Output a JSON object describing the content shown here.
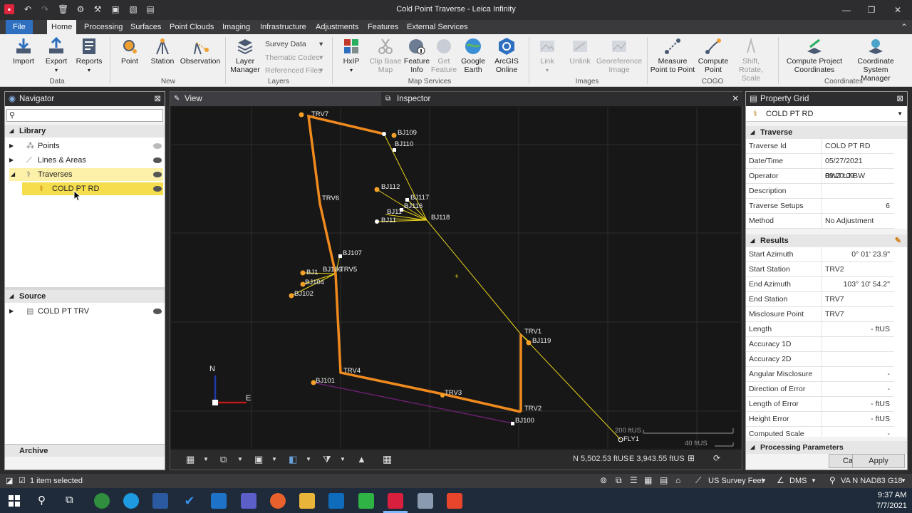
{
  "window": {
    "title": "Cold Point Traverse - Leica Infinity"
  },
  "menu": {
    "tabs": [
      "File",
      "Home",
      "Processing",
      "Surfaces",
      "Point Clouds",
      "Imaging",
      "Infrastructure",
      "Adjustments",
      "Features",
      "External Services"
    ]
  },
  "ribbon": {
    "import": "Import",
    "export": "Export",
    "reports": "Reports",
    "group_data": "Data",
    "point": "Point",
    "station": "Station",
    "observation": "Observation",
    "group_new": "New",
    "layer_manager": "Layer Manager",
    "survey_data": "Survey Data",
    "thematic_codes": "Thematic Codes",
    "referenced_files": "Referenced Files",
    "group_layers": "Layers",
    "hxip": "HxIP",
    "clip_base_map": "Clip Base Map",
    "feature_info": "Feature Info",
    "get_feature": "Get Feature",
    "google_earth": "Google Earth",
    "arcgis_online": "ArcGIS Online",
    "group_map_services": "Map Services",
    "link": "Link",
    "unlink": "Unlink",
    "georeference_image": "Georeference Image",
    "group_images": "Images",
    "measure_point": "Measure Point to Point",
    "compute_point": "Compute Point",
    "shift_rotate": "Shift, Rotate, Scale",
    "group_cogo": "COGO",
    "compute_project_coords": "Compute Project Coordinates",
    "coordinate_system_manager": "Coordinate System Manager",
    "group_coordinates": "Coordinates"
  },
  "navigator": {
    "title": "Navigator",
    "search_placeholder": "",
    "library": "Library",
    "items": [
      "Points",
      "Lines & Areas",
      "Traverses",
      "COLD PT RD"
    ],
    "source": "Source",
    "source_items": [
      "COLD PT TRV"
    ],
    "archive": "Archive"
  },
  "view": {
    "tab_view": "View",
    "tab_inspector": "Inspector",
    "coord_n": "N 5,502.53 ftUS",
    "coord_e": "E 3,943.55 ftUS",
    "scale_big": "200 ftUS",
    "scale_small": "40 ftUS",
    "north": "N",
    "east": "E",
    "labels": {
      "TRV7": "TRV7",
      "BJ109": "BJ109",
      "BJ110": "BJ110",
      "BJ112": "BJ112",
      "BJ117": "BJ117",
      "BJ116": "BJ116",
      "BJ11a": "BJ11",
      "BJ11b": "BJ11",
      "BJ118": "BJ118",
      "TRV6": "TRV6",
      "BJ107": "BJ107",
      "BJ1a": "BJ1",
      "BJ106": "BJ106",
      "TRV5": "TRV5",
      "BJ104": "BJ104",
      "BJ102": "BJ102",
      "TRV1": "TRV1",
      "BJ119": "BJ119",
      "TRV4": "TRV4",
      "BJ101": "BJ101",
      "TRV3": "TRV3",
      "TRV2": "TRV2",
      "BJ100": "BJ100",
      "FLY1": "FLY1"
    }
  },
  "property_grid": {
    "title": "Property Grid",
    "selector": "COLD PT RD",
    "section_traverse": "Traverse",
    "traverse": [
      {
        "k": "Traverse Id",
        "v": "COLD PT RD"
      },
      {
        "k": "Date/Time",
        "v": "05/27/2021 09:20:09"
      },
      {
        "k": "Operator",
        "v": "BWJ LJ BW"
      },
      {
        "k": "Description",
        "v": ""
      },
      {
        "k": "Traverse Setups",
        "v": "6"
      },
      {
        "k": "Method",
        "v": "No Adjustment"
      }
    ],
    "section_results": "Results",
    "results": [
      {
        "k": "Start Azimuth",
        "v": "0° 01' 23.9\""
      },
      {
        "k": "Start Station",
        "v": "TRV2"
      },
      {
        "k": "End Azimuth",
        "v": "103° 10' 54.2\""
      },
      {
        "k": "End Station",
        "v": "TRV7"
      },
      {
        "k": "Misclosure Point",
        "v": "TRV7"
      },
      {
        "k": "Length",
        "v": "- ftUS"
      },
      {
        "k": "Accuracy 1D",
        "v": ""
      },
      {
        "k": "Accuracy 2D",
        "v": ""
      },
      {
        "k": "Angular Misclosure",
        "v": "-"
      },
      {
        "k": "Direction of Error",
        "v": "-"
      },
      {
        "k": "Length of Error",
        "v": "- ftUS"
      },
      {
        "k": "Height Error",
        "v": "- ftUS"
      },
      {
        "k": "Computed Scale",
        "v": "-"
      }
    ],
    "section_processing": "Processing Parameters",
    "cancel": "Cancel",
    "apply": "Apply"
  },
  "status": {
    "selected": "1 item selected",
    "units": "US Survey Feet",
    "angle": "DMS",
    "crs": "VA N NAD83 G18"
  },
  "taskbar": {
    "time": "9:37 AM",
    "date": "7/7/2021"
  },
  "colors": {
    "traverse": "#f08a1e",
    "ray": "#e8d21a",
    "accent": "#2e6fbf",
    "highlight": "#fdf0a8"
  }
}
